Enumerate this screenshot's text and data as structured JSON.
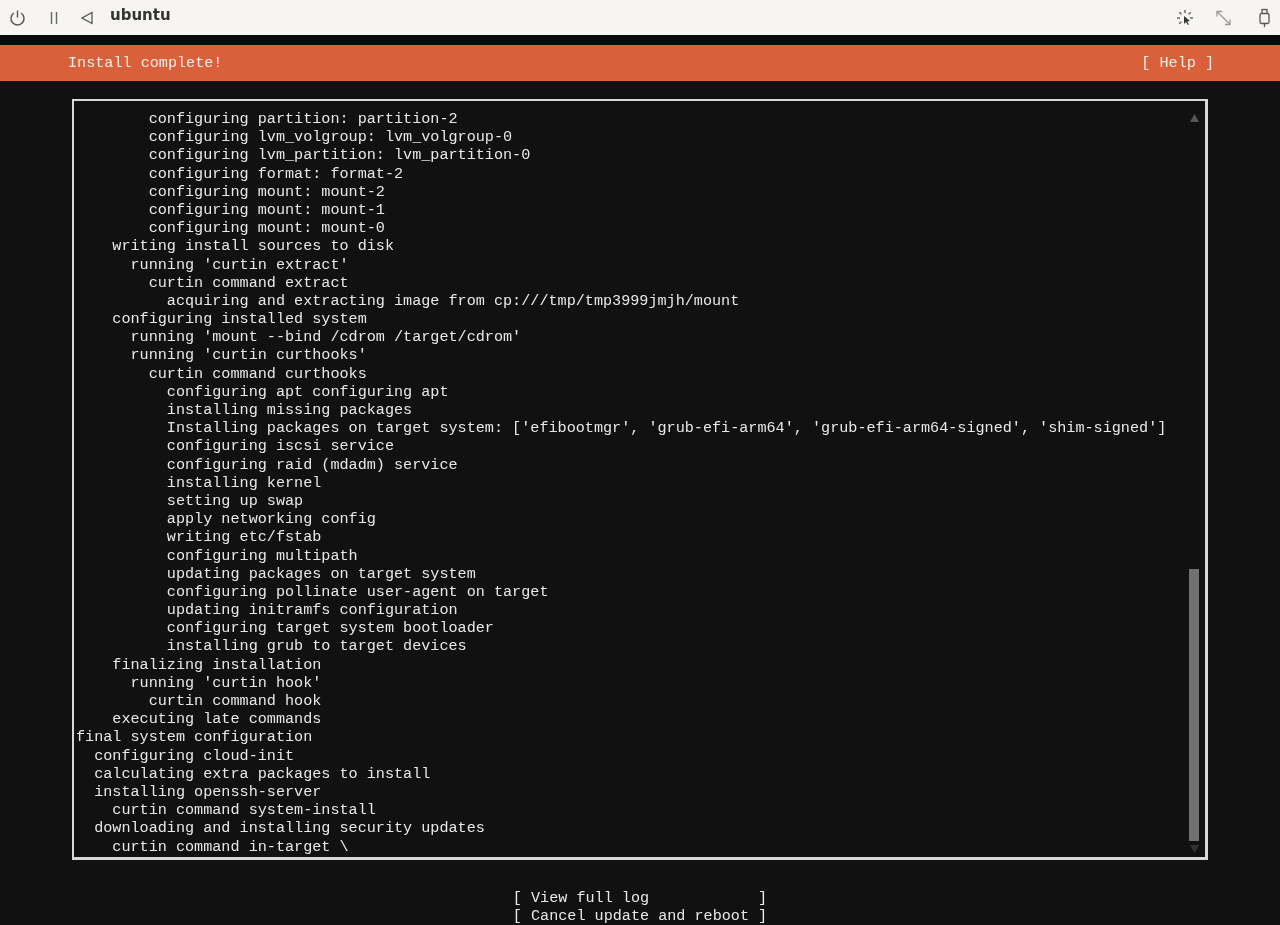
{
  "window": {
    "title": "ubuntu"
  },
  "header": {
    "title": "Install complete!",
    "help": "[ Help ]"
  },
  "log": {
    "lines": [
      "        configuring partition: partition-2",
      "        configuring lvm_volgroup: lvm_volgroup-0",
      "        configuring lvm_partition: lvm_partition-0",
      "        configuring format: format-2",
      "        configuring mount: mount-2",
      "        configuring mount: mount-1",
      "        configuring mount: mount-0",
      "    writing install sources to disk",
      "      running 'curtin extract'",
      "        curtin command extract",
      "          acquiring and extracting image from cp:///tmp/tmp3999jmjh/mount",
      "    configuring installed system",
      "      running 'mount --bind /cdrom /target/cdrom'",
      "      running 'curtin curthooks'",
      "        curtin command curthooks",
      "          configuring apt configuring apt",
      "          installing missing packages",
      "          Installing packages on target system: ['efibootmgr', 'grub-efi-arm64', 'grub-efi-arm64-signed', 'shim-signed']",
      "          configuring iscsi service",
      "          configuring raid (mdadm) service",
      "          installing kernel",
      "          setting up swap",
      "          apply networking config",
      "          writing etc/fstab",
      "          configuring multipath",
      "          updating packages on target system",
      "          configuring pollinate user-agent on target",
      "          updating initramfs configuration",
      "          configuring target system bootloader",
      "          installing grub to target devices",
      "    finalizing installation",
      "      running 'curtin hook'",
      "        curtin command hook",
      "    executing late commands",
      "final system configuration",
      "  configuring cloud-init",
      "  calculating extra packages to install",
      "  installing openssh-server",
      "    curtin command system-install",
      "  downloading and installing security updates",
      "    curtin command in-target \\"
    ]
  },
  "buttons": [
    "[ View full log            ]",
    "[ Cancel update and reboot ]"
  ]
}
